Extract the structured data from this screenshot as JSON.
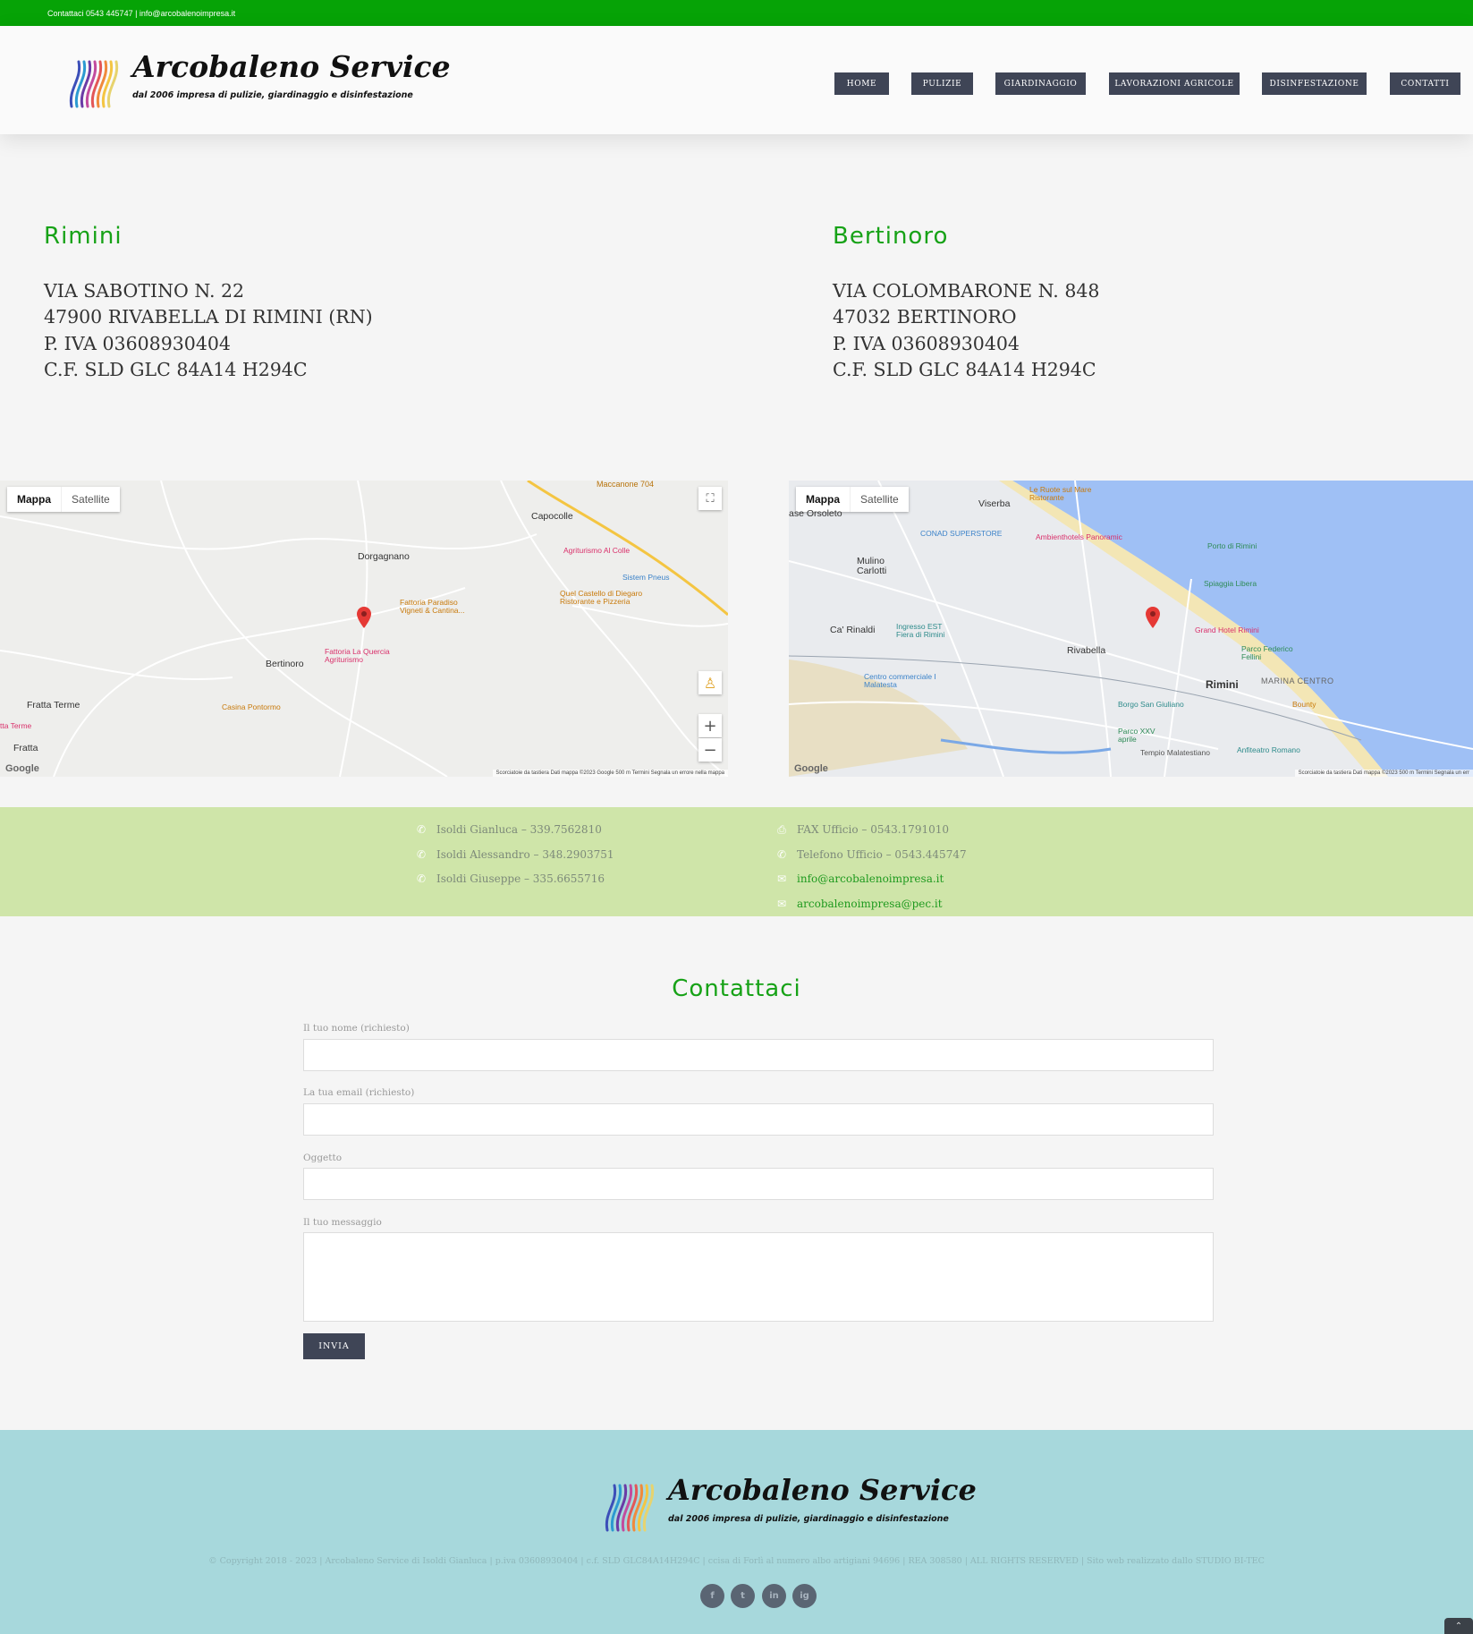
{
  "topbar": {
    "text": "Contattaci 0543 445747  |  info@arcobalenoimpresa.it"
  },
  "brand": {
    "name": "Arcobaleno Service",
    "tagline": "dal 2006 impresa di pulizie, giardinaggio e disinfestazione"
  },
  "nav": {
    "items": [
      "HOME",
      "PULIZIE",
      "GIARDINAGGIO",
      "LAVORAZIONI AGRICOLE",
      "DISINFESTAZIONE",
      "CONTATTI"
    ]
  },
  "offices": [
    {
      "city": "Rimini",
      "lines": [
        "VIA SABOTINO  N. 22",
        "47900 RIVABELLA DI RIMINI (RN)",
        "P. IVA 03608930404",
        "C.F. SLD GLC 84A14 H294C"
      ]
    },
    {
      "city": "Bertinoro",
      "lines": [
        "VIA COLOMBARONE N. 848",
        "47032 BERTINORO",
        "P. IVA 03608930404",
        "C.F. SLD GLC 84A14 H294C"
      ]
    }
  ],
  "maps": {
    "toggle_map": "Mappa",
    "toggle_satellite": "Satellite",
    "google": "Google",
    "left": {
      "labels": [
        "Maccanone 704",
        "Capocolle",
        "Dorgagnano",
        "Bertinoro",
        "Fratta Terme",
        "Fratta"
      ],
      "pois": [
        "Agriturismo Al Colle",
        "Sistem Pneus",
        "Quel Castello di Diegaro Ristorante e Pizzeria",
        "Fattoria Paradiso Vigneti & Cantina...",
        "Fattoria La Quercia Agriturismo",
        "Casina Pontormo",
        "tta Terme"
      ],
      "footer": "Scorciatoie da tastiera   Dati mappa ©2023 Google   500 m   Termini   Segnala un errore nella mappa"
    },
    "right": {
      "labels": [
        "ase Orsoleto",
        "Viserba",
        "Mulino Carlotti",
        "Ca' Rinaldi",
        "Rivabella",
        "Rimini",
        "MARINA CENTRO"
      ],
      "pois": [
        "Le Ruote sul Mare Ristorante",
        "CONAD SUPERSTORE",
        "Ambienthotels Panoramic",
        "Porto di Rimini",
        "Spiaggia Libera",
        "Ingresso EST Fiera di Rimini",
        "Grand Hotel Rimini",
        "Parco Federico Fellini",
        "Centro commerciale I Malatesta",
        "Borgo San Giuliano",
        "Bounty",
        "Parco XXV aprile",
        "Tempio Malatestiano",
        "Anfiteatro Romano"
      ],
      "footer": "Scorciatoie da tastiera   Dati mappa ©2023   500 m   Termini   Segnala un err"
    }
  },
  "contacts": {
    "left": [
      "Isoldi Gianluca – 339.7562810",
      "Isoldi Alessandro – 348.2903751",
      "Isoldi Giuseppe – 335.6655716"
    ],
    "right": [
      "FAX Ufficio – 0543.1791010",
      "Telefono Ufficio – 0543.445747",
      "info@arcobalenoimpresa.it",
      "arcobalenoimpresa@pec.it"
    ]
  },
  "form": {
    "title": "Contattaci",
    "name_label": "Il tuo nome (richiesto)",
    "email_label": "La tua email (richiesto)",
    "subject_label": "Oggetto",
    "message_label": "Il tuo messaggio",
    "submit": "INVIA"
  },
  "footer": {
    "copyright": "© Copyright 2018 - 2023   |   Arcobaleno Service di Isoldi Gianluca   |   p.iva 03608930404   |   c.f. SLD GLC84A14H294C   |   ccisa di Forlì al numero albo artigiani 94696   |   REA 308580   |   ALL RIGHTS RESERVED   |   Sito web realizzato dallo STUDIO BI-TEC",
    "social": [
      "f",
      "t",
      "in",
      "ig"
    ]
  }
}
